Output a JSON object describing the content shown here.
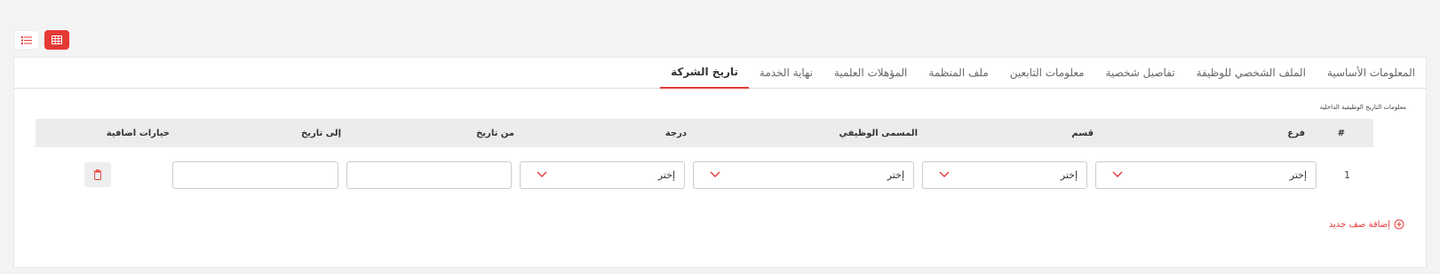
{
  "view_toggle": {
    "list_icon": "list-icon",
    "grid_icon": "grid-icon",
    "active": "grid"
  },
  "tabs": [
    {
      "label": "المعلومات الأساسية",
      "active": false
    },
    {
      "label": "الملف الشخصي للوظيفة",
      "active": false
    },
    {
      "label": "تفاصيل شخصية",
      "active": false
    },
    {
      "label": "معلومات التابعين",
      "active": false
    },
    {
      "label": "ملف المنظمة",
      "active": false
    },
    {
      "label": "المؤهلات العلمية",
      "active": false
    },
    {
      "label": "نهاية الخدمة",
      "active": false
    },
    {
      "label": "تاريخ الشركة",
      "active": true
    }
  ],
  "section": {
    "title": "معلومات التاريخ الوظيفية الداخلية"
  },
  "table": {
    "headers": {
      "num": "#",
      "branch": "فرع",
      "department": "قسم",
      "job_title": "المسمى الوظيفي",
      "grade": "درجة",
      "from_date": "من تاريخ",
      "to_date": "إلى تاريخ",
      "options": "خيارات اضافية"
    },
    "rows": [
      {
        "num": "1",
        "branch": "إختر",
        "department": "إختر",
        "job_title": "إختر",
        "grade": "إختر",
        "from_date": "",
        "to_date": ""
      }
    ]
  },
  "add_row": {
    "label": "إضافة صف جديد",
    "icon": "plus-circle-icon"
  },
  "colors": {
    "accent": "#e53935",
    "header_bg": "#ececec",
    "page_bg": "#f3f3f3"
  }
}
